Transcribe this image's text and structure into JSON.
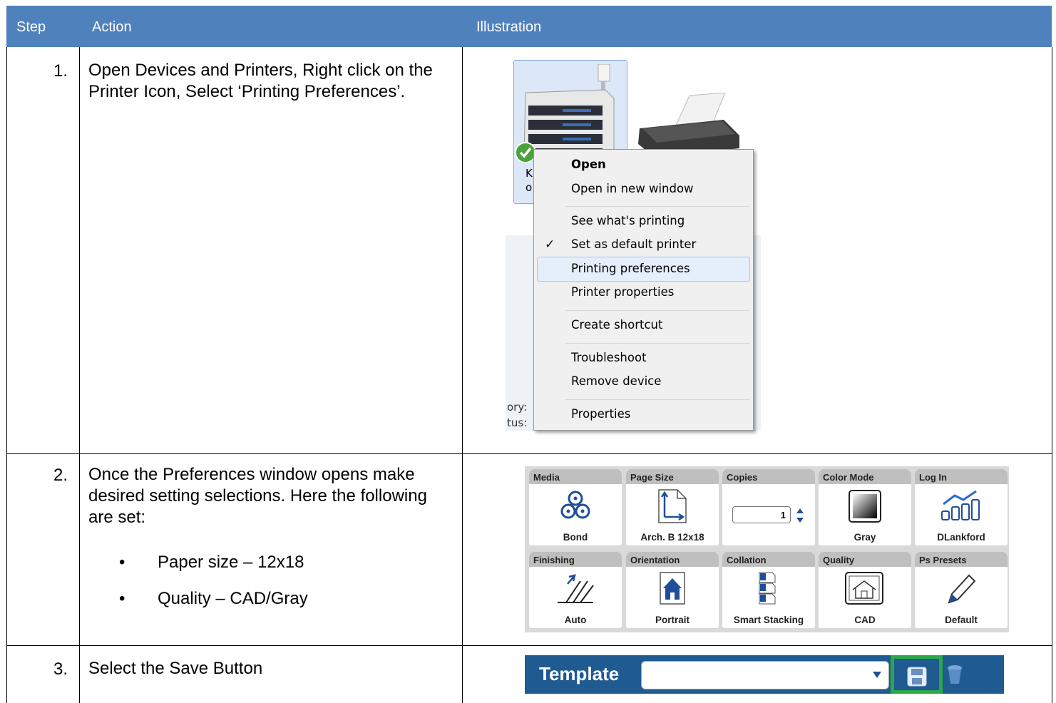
{
  "header": {
    "step": "Step",
    "action": "Action",
    "illustration": "Illustration"
  },
  "rows": [
    {
      "num": "1.",
      "text": "Open Devices and Printers, Right click on the Printer Icon, Select ‘Printing Preferences’."
    },
    {
      "num": "2.",
      "text": "Once the Preferences window opens make desired setting selections. Here the following are set:",
      "bullets": [
        "Paper size – 12x18",
        "Quality – CAD/Gray"
      ]
    },
    {
      "num": "3.",
      "text": "Select the Save Button"
    }
  ],
  "context_menu": {
    "items": [
      "Open",
      "Open in new window",
      "See what's printing",
      "Set as default printer",
      "Printing preferences",
      "Printer properties",
      "Create shortcut",
      "Troubleshoot",
      "Remove device",
      "Properties"
    ],
    "checkmark": "✓",
    "device_label_fragments": [
      "K",
      "o"
    ],
    "status_fragments": [
      "ory:",
      "tus:"
    ]
  },
  "preferences": {
    "cards": [
      {
        "title": "Media",
        "value": "Bond",
        "icon": "media-icon"
      },
      {
        "title": "Page Size",
        "value": "Arch. B 12x18",
        "icon": "page-size-icon"
      },
      {
        "title": "Copies",
        "value": "1",
        "icon": "spinner-icon"
      },
      {
        "title": "Color Mode",
        "value": "Gray",
        "icon": "gray-gradient-icon"
      },
      {
        "title": "Log In",
        "value": "DLankford",
        "icon": "login-chart-icon"
      },
      {
        "title": "Finishing",
        "value": "Auto",
        "icon": "finishing-icon"
      },
      {
        "title": "Orientation",
        "value": "Portrait",
        "icon": "house-portrait-icon"
      },
      {
        "title": "Collation",
        "value": "Smart Stacking",
        "icon": "stack-icon"
      },
      {
        "title": "Quality",
        "value": "CAD",
        "icon": "cad-drawing-icon"
      },
      {
        "title": "Ps Presets",
        "value": "Default",
        "icon": "pen-icon"
      }
    ]
  },
  "template_bar": {
    "label": "Template",
    "value": "",
    "highlight_color": "#2aa84a",
    "bar_color": "#1f5a91"
  },
  "colors": {
    "header": "#4f81bd",
    "header_text": "#ffffff"
  }
}
